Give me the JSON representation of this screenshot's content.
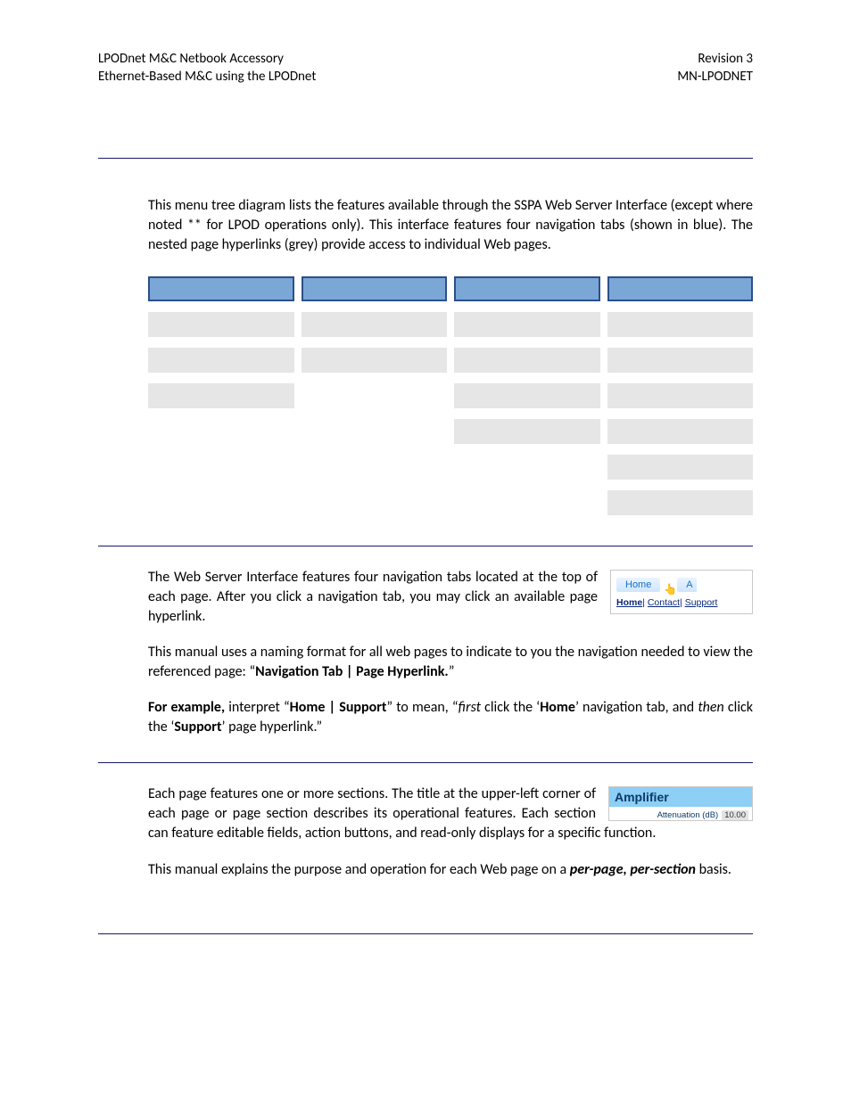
{
  "header": {
    "left1": "LPODnet M&C Netbook Accessory",
    "left2": "Ethernet-Based M&C using the LPODnet",
    "right1": "Revision 3",
    "right2": "MN-LPODNET"
  },
  "intro": "This menu tree diagram lists the features available through the SSPA Web Server Interface (except where noted ** for LPOD operations only). This interface features four navigation tabs (shown in blue). The nested page hyperlinks (grey) provide access to individual Web pages.",
  "tree": {
    "cols": 4,
    "tab_row": true,
    "link_rows": [
      [
        true,
        true,
        true,
        true
      ],
      [
        true,
        true,
        true,
        true
      ],
      [
        true,
        false,
        true,
        true
      ],
      [
        false,
        false,
        true,
        true
      ],
      [
        false,
        false,
        false,
        true
      ],
      [
        false,
        false,
        false,
        true
      ]
    ]
  },
  "nav_section": {
    "p1": "The Web Server Interface features four navigation tabs located at the top of each page. After you click a navigation tab, you may click an available page hyperlink.",
    "p2_pre": "This manual uses a naming format for all web pages to indicate to you the navigation needed to view the referenced page: “",
    "p2_bold": "Navigation Tab | Page Hyperlink.",
    "p2_post": "”",
    "p3_a": "For example,",
    "p3_b": " interpret “",
    "p3_c": "Home | Support",
    "p3_d": "” to mean, “",
    "p3_e": "first",
    "p3_f": " click the ‘",
    "p3_g": "Home",
    "p3_h": "’ navigation tab, and ",
    "p3_i": "then",
    "p3_j": " click the ‘",
    "p3_k": "Support",
    "p3_l": "’ page hyperlink.”",
    "thumb": {
      "tab1": "Home",
      "tab2_partial": "A",
      "links": [
        "Home",
        "Contact",
        "Support"
      ]
    }
  },
  "amp_section": {
    "p1": "Each page features one or more sections. The title at the upper-left corner of each page or page section describes its operational features. Each section can feature editable fields, action buttons, and read-only displays for a specific function.",
    "p2_pre": "This manual explains the purpose and operation for each Web page on a ",
    "p2_em": "per-page, per-section",
    "p2_post": " basis.",
    "thumb": {
      "title": "Amplifier",
      "label": "Attenuation (dB)",
      "value": "10.00"
    }
  }
}
